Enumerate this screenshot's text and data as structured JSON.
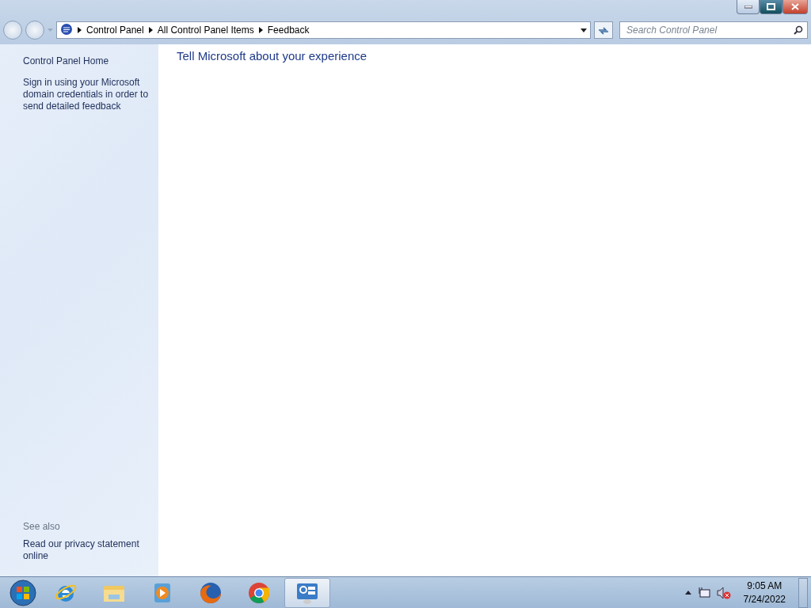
{
  "breadcrumb": [
    "Control Panel",
    "All Control Panel Items",
    "Feedback"
  ],
  "search": {
    "placeholder": "Search Control Panel"
  },
  "sidebar": {
    "links": [
      "Control Panel Home",
      "Sign in using your Microsoft domain credentials in order to send detailed feedback"
    ],
    "see_also_label": "See also",
    "see_also": [
      "Read our privacy statement online"
    ]
  },
  "heading": "Tell Microsoft about your experience",
  "taskbar": {
    "items": [
      {
        "kind": "ie",
        "selected": false
      },
      {
        "kind": "folder",
        "selected": false
      },
      {
        "kind": "media",
        "selected": false
      },
      {
        "kind": "firefox",
        "selected": false
      },
      {
        "kind": "chrome",
        "selected": false
      },
      {
        "kind": "controlpanel",
        "selected": true
      }
    ],
    "clock": {
      "time": "9:05 AM",
      "date": "7/24/2022"
    }
  }
}
